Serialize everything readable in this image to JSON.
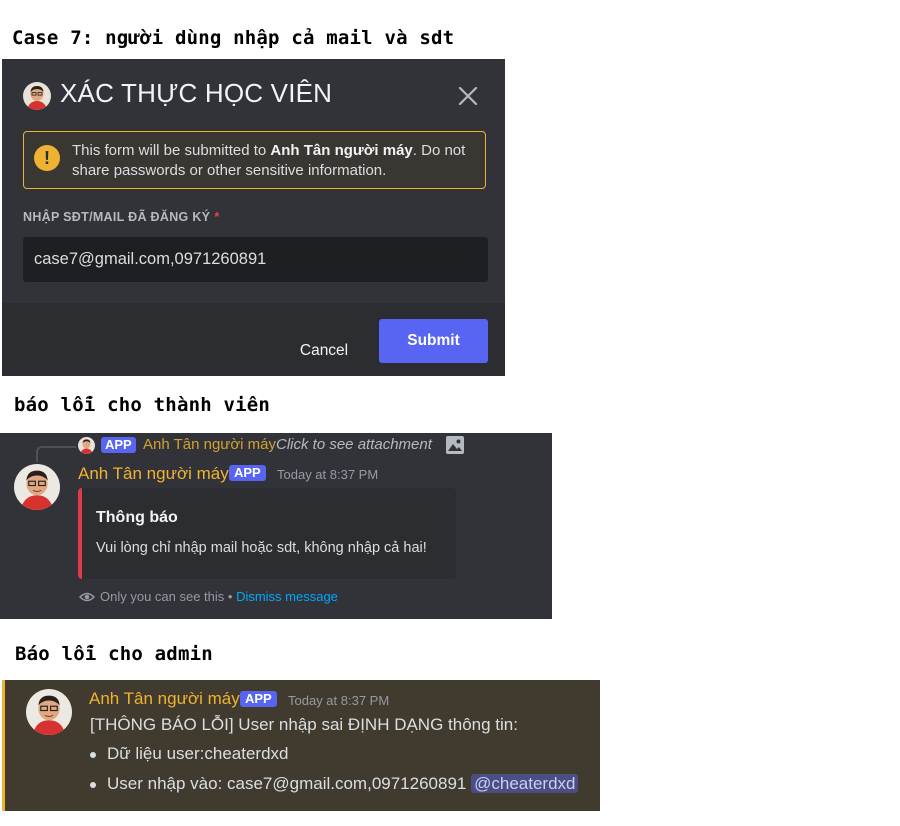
{
  "headings": {
    "case": "Case 7: người dùng nhập cả mail và sdt",
    "member_error": "báo lỗi cho thành viên",
    "admin_error": "Báo lỗi cho admin"
  },
  "modal": {
    "title": "XÁC THỰC HỌC VIÊN",
    "warning_prefix": "This form will be submitted to ",
    "warning_bot": "Anh Tân người máy",
    "warning_suffix": ". Do not share passwords or other sensitive information.",
    "field_label": "NHẬP SĐT/MAIL ĐÃ ĐĂNG KÝ",
    "required_mark": "*",
    "field_value": "case7@gmail.com,0971260891",
    "cancel_label": "Cancel",
    "submit_label": "Submit"
  },
  "message_member": {
    "reply": {
      "badge": "APP",
      "author": "Anh Tân người máy",
      "attachment_text": "Click to see attachment"
    },
    "author": "Anh Tân người máy",
    "badge": "APP",
    "timestamp": "Today at 8:37 PM",
    "embed_title": "Thông báo",
    "embed_description": "Vui lòng chỉ nhập mail hoặc sdt, không nhập cả hai!",
    "ephemeral_text": "Only you can see this • ",
    "dismiss_label": "Dismiss message"
  },
  "message_admin": {
    "author": "Anh Tân người máy",
    "badge": "APP",
    "timestamp": "Today at 8:37 PM",
    "line": "[THÔNG BÁO LỖI] User nhập sai ĐỊNH DẠNG thông tin:",
    "bullets": [
      "Dữ liệu user:cheaterdxd",
      "User nhập vào: case7@gmail.com,0971260891"
    ],
    "mention": "@cheaterdxd"
  },
  "colors": {
    "blurple": "#5865f2",
    "bot_name": "#f0b232",
    "warning_border": "#f0b232",
    "embed_bar": "#e23b44",
    "link": "#00a8fc"
  }
}
